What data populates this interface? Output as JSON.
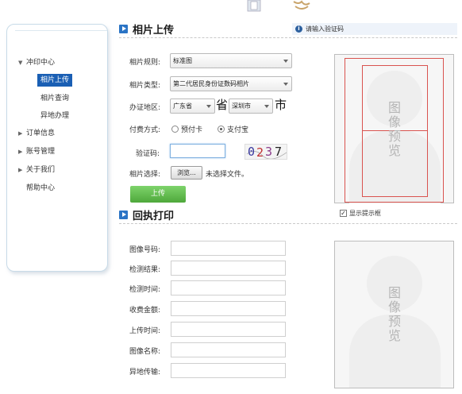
{
  "sidebar": {
    "items": [
      {
        "label": "冲印中心",
        "expanded": true
      },
      {
        "label": "订单信息",
        "expanded": false
      },
      {
        "label": "账号管理",
        "expanded": false
      },
      {
        "label": "关于我们",
        "expanded": false
      },
      {
        "label": "帮助中心",
        "expanded": null
      }
    ],
    "sub_items": [
      {
        "label": "相片上传",
        "active": true
      },
      {
        "label": "相片查询",
        "active": false
      },
      {
        "label": "异地办理",
        "active": false
      }
    ]
  },
  "upload_section": {
    "title": "相片上传",
    "hint": "请输入验证码",
    "hint_icon": "info-icon",
    "labels": {
      "spec": "相片规则:",
      "type": "相片类型:",
      "region": "办证地区:",
      "payment": "付费方式:",
      "captcha": "验证码:",
      "file": "相片选择:"
    },
    "spec_value": "标准图",
    "type_value": "第二代居民身份证数码相片",
    "province_value": "广东省",
    "province_suffix": "省",
    "city_value": "深圳市",
    "city_suffix": "市",
    "payment_options": [
      {
        "label": "预付卡",
        "selected": false
      },
      {
        "label": "支付宝",
        "selected": true
      }
    ],
    "captcha_input_value": "",
    "captcha_chars": [
      "0",
      "2",
      "3",
      "7"
    ],
    "browse_label": "浏览...",
    "file_status": "未选择文件。",
    "upload_label": "上传",
    "preview_text": "图像预览",
    "show_frame_label": "显示提示框",
    "show_frame_checked": true
  },
  "receipt_section": {
    "title": "回执打印",
    "fields": [
      {
        "label": "图像号码:",
        "value": ""
      },
      {
        "label": "检测结果:",
        "value": ""
      },
      {
        "label": "检测时间:",
        "value": ""
      },
      {
        "label": "收费金额:",
        "value": ""
      },
      {
        "label": "上传时间:",
        "value": ""
      },
      {
        "label": "图像名称:",
        "value": ""
      },
      {
        "label": "异地传输:",
        "value": ""
      }
    ],
    "preview_text": "图像预览"
  },
  "colors": {
    "accent": "#1a5fb4",
    "section_icon": "#2b74c5",
    "upload_button": "#5cb848",
    "guide_line": "#d9534f"
  }
}
